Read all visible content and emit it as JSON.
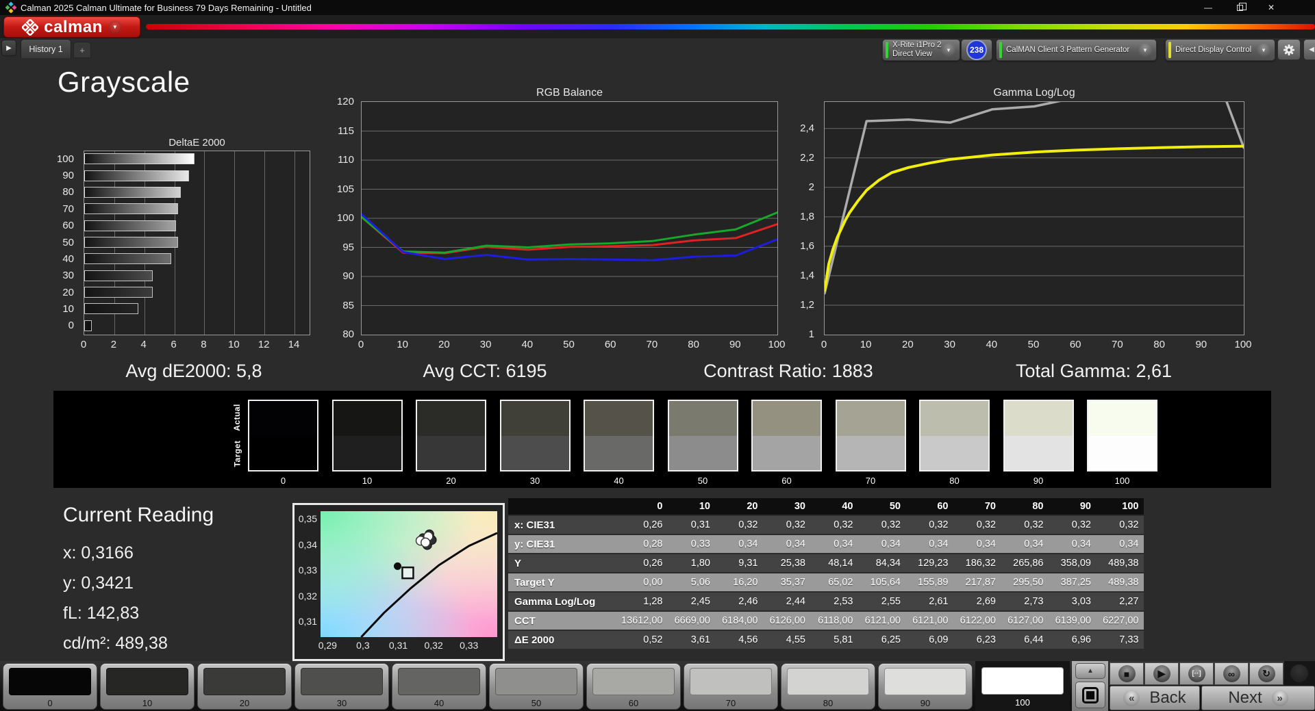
{
  "window": {
    "title": "Calman 2025 Calman Ultimate for Business 79 Days Remaining  - Untitled"
  },
  "brand": {
    "logo_text": "calman"
  },
  "tabs": {
    "history": "History 1",
    "add": "+"
  },
  "toolbar": {
    "meter": {
      "line1": "X-Rite i1Pro 2",
      "line2": "Direct View",
      "badge": "238",
      "accent": "#35d435"
    },
    "pattern_generator": {
      "label": "CalMAN Client 3 Pattern Generator",
      "accent": "#35d435"
    },
    "display_control": {
      "label": "Direct Display Control",
      "accent": "#e3df2e"
    }
  },
  "page": {
    "title": "Grayscale"
  },
  "stats": [
    "Avg dE2000: 5,8",
    "Avg CCT: 6195",
    "Contrast Ratio: 1883",
    "Total Gamma: 2,61"
  ],
  "chart_data": [
    {
      "type": "bar",
      "title": "DeltaE 2000",
      "orientation": "horizontal",
      "categories": [
        "100",
        "90",
        "80",
        "70",
        "60",
        "50",
        "40",
        "30",
        "20",
        "10",
        "0"
      ],
      "values": [
        7.33,
        6.96,
        6.44,
        6.23,
        6.09,
        6.25,
        5.81,
        4.55,
        4.56,
        3.61,
        0.52
      ],
      "xlim": [
        0,
        15
      ],
      "xticks": [
        0,
        2,
        4,
        6,
        8,
        10,
        12,
        14
      ],
      "bar_colors": [
        "#ffffff",
        "#e9e9e9",
        "#d2d2d2",
        "#bcbcbc",
        "#a5a5a5",
        "#8f8f8f",
        "#6f6f6f",
        "#4c4c4c",
        "#3b3b3b",
        "#242424",
        "#0d0d0d"
      ]
    },
    {
      "type": "line",
      "title": "RGB Balance",
      "x": [
        0,
        10,
        20,
        30,
        40,
        50,
        60,
        70,
        80,
        90,
        100
      ],
      "xlim": [
        0,
        100
      ],
      "ylim": [
        80,
        120
      ],
      "yticks": [
        {
          "v": 120,
          "label": "120"
        },
        {
          "v": 115,
          "label": "115"
        },
        {
          "v": 110,
          "label": "110"
        },
        {
          "v": 105,
          "label": "105"
        },
        {
          "v": 100,
          "label": "100"
        },
        {
          "v": 95,
          "label": "95"
        },
        {
          "v": 90,
          "label": "90"
        },
        {
          "v": 85,
          "label": "85"
        },
        {
          "v": 80,
          "label": "80"
        }
      ],
      "xticks": [
        0,
        10,
        20,
        30,
        40,
        50,
        60,
        70,
        80,
        90,
        100
      ],
      "series": [
        {
          "name": "Red",
          "color": "#de2323",
          "values": [
            100.2,
            94.1,
            94.0,
            95.1,
            94.6,
            95.1,
            95.2,
            95.4,
            96.2,
            96.6,
            99.0
          ]
        },
        {
          "name": "Green",
          "color": "#17a82b",
          "values": [
            100.2,
            94.3,
            94.1,
            95.3,
            95.0,
            95.5,
            95.7,
            96.1,
            97.2,
            98.1,
            101.0
          ]
        },
        {
          "name": "Blue",
          "color": "#1d1de0",
          "values": [
            100.7,
            94.2,
            93.0,
            93.7,
            92.9,
            93.0,
            92.9,
            92.8,
            93.4,
            93.6,
            96.4
          ]
        }
      ]
    },
    {
      "type": "line",
      "title": "Gamma Log/Log",
      "xlim": [
        0,
        100
      ],
      "ylim": [
        1,
        2.58
      ],
      "yticks": [
        {
          "v": 2.4,
          "label": "2,4"
        },
        {
          "v": 2.2,
          "label": "2,2"
        },
        {
          "v": 2.0,
          "label": "2"
        },
        {
          "v": 1.8,
          "label": "1,8"
        },
        {
          "v": 1.6,
          "label": "1,6"
        },
        {
          "v": 1.4,
          "label": "1,4"
        },
        {
          "v": 1.2,
          "label": "1,2"
        },
        {
          "v": 1.0,
          "label": "1"
        }
      ],
      "xticks": [
        0,
        10,
        20,
        30,
        40,
        50,
        60,
        70,
        80,
        90,
        100
      ],
      "series": [
        {
          "name": "Measured Gamma",
          "color": "#ababab",
          "width": 3.5,
          "x": [
            0,
            10,
            20,
            30,
            40,
            50,
            60,
            70,
            80,
            90,
            100
          ],
          "values": [
            1.28,
            2.45,
            2.46,
            2.44,
            2.53,
            2.55,
            2.61,
            2.69,
            2.73,
            3.03,
            2.27
          ]
        },
        {
          "name": "Target Gamma",
          "color": "#f2ee12",
          "width": 4,
          "x": [
            0,
            1,
            2,
            3,
            4,
            5,
            6,
            8,
            10,
            13,
            16,
            20,
            25,
            30,
            35,
            40,
            50,
            60,
            70,
            80,
            90,
            100
          ],
          "values": [
            1.3,
            1.48,
            1.58,
            1.66,
            1.72,
            1.78,
            1.83,
            1.91,
            1.98,
            2.05,
            2.1,
            2.135,
            2.165,
            2.19,
            2.205,
            2.22,
            2.24,
            2.253,
            2.262,
            2.27,
            2.276,
            2.28
          ]
        }
      ]
    },
    {
      "type": "scatter",
      "title": "CIE xy chromaticity detail",
      "xlim": [
        0.288,
        0.338
      ],
      "ylim": [
        0.304,
        0.353
      ],
      "xticks": [
        {
          "v": 0.29,
          "label": "0,29"
        },
        {
          "v": 0.3,
          "label": "0,3"
        },
        {
          "v": 0.31,
          "label": "0,31"
        },
        {
          "v": 0.32,
          "label": "0,32"
        },
        {
          "v": 0.33,
          "label": "0,33"
        }
      ],
      "yticks": [
        {
          "v": 0.35,
          "label": "0,35"
        },
        {
          "v": 0.34,
          "label": "0,34"
        },
        {
          "v": 0.33,
          "label": "0,33"
        },
        {
          "v": 0.32,
          "label": "0,32"
        },
        {
          "v": 0.31,
          "label": "0,31"
        }
      ],
      "locus": [
        [
          0.2995,
          0.304
        ],
        [
          0.306,
          0.3135
        ],
        [
          0.3135,
          0.323
        ],
        [
          0.3215,
          0.332
        ],
        [
          0.33,
          0.3395
        ],
        [
          0.338,
          0.3445
        ]
      ],
      "measured_points": [
        [
          0.3163,
          0.3415
        ],
        [
          0.3185,
          0.3432
        ],
        [
          0.3177,
          0.3408
        ]
      ],
      "dark_points": [
        [
          0.3182,
          0.3398
        ],
        [
          0.3195,
          0.3418
        ],
        [
          0.317,
          0.3425
        ],
        [
          0.3188,
          0.344
        ]
      ],
      "reading_point": [
        0.3098,
        0.3316
      ],
      "target_point": [
        0.3127,
        0.329
      ]
    }
  ],
  "swatch_strip": {
    "row_labels": [
      "Actual",
      "Target"
    ],
    "levels": [
      "0",
      "10",
      "20",
      "30",
      "40",
      "50",
      "60",
      "70",
      "80",
      "90",
      "100"
    ],
    "actual_colors": [
      "#020204",
      "#161614",
      "#2b2b27",
      "#403f38",
      "#555349",
      "#7b7a6f",
      "#949180",
      "#a5a494",
      "#bdbdad",
      "#dcdcca",
      "#f7fcef"
    ],
    "target_colors": [
      "#000000",
      "#1f1f1f",
      "#373737",
      "#4d4d4d",
      "#696968",
      "#8c8c8c",
      "#a4a4a4",
      "#b5b5b5",
      "#c9c9c9",
      "#e3e3e3",
      "#fdfdfd"
    ]
  },
  "current_reading": {
    "title": "Current Reading",
    "lines": [
      "x: 0,3166",
      "y: 0,3421",
      "fL: 142,83",
      "cd/m²: 489,38"
    ]
  },
  "table": {
    "col_headers": [
      "",
      "0",
      "10",
      "20",
      "30",
      "40",
      "50",
      "60",
      "70",
      "80",
      "90",
      "100"
    ],
    "rows": [
      {
        "label": "x: CIE31",
        "tone": "dark",
        "values": [
          "0,26",
          "0,31",
          "0,32",
          "0,32",
          "0,32",
          "0,32",
          "0,32",
          "0,32",
          "0,32",
          "0,32",
          "0,32"
        ]
      },
      {
        "label": "y: CIE31",
        "tone": "light",
        "values": [
          "0,28",
          "0,33",
          "0,34",
          "0,34",
          "0,34",
          "0,34",
          "0,34",
          "0,34",
          "0,34",
          "0,34",
          "0,34"
        ]
      },
      {
        "label": "Y",
        "tone": "dark",
        "values": [
          "0,26",
          "1,80",
          "9,31",
          "25,38",
          "48,14",
          "84,34",
          "129,23",
          "186,32",
          "265,86",
          "358,09",
          "489,38"
        ]
      },
      {
        "label": "Target Y",
        "tone": "light",
        "values": [
          "0,00",
          "5,06",
          "16,20",
          "35,37",
          "65,02",
          "105,64",
          "155,89",
          "217,87",
          "295,50",
          "387,25",
          "489,38"
        ]
      },
      {
        "label": "Gamma Log/Log",
        "tone": "dark",
        "values": [
          "1,28",
          "2,45",
          "2,46",
          "2,44",
          "2,53",
          "2,55",
          "2,61",
          "2,69",
          "2,73",
          "3,03",
          "2,27"
        ]
      },
      {
        "label": "CCT",
        "tone": "light",
        "values": [
          "13612,00",
          "6669,00",
          "6184,00",
          "6126,00",
          "6118,00",
          "6121,00",
          "6121,00",
          "6122,00",
          "6127,00",
          "6139,00",
          "6227,00"
        ]
      },
      {
        "label": "ΔE 2000",
        "tone": "dark",
        "values": [
          "0,52",
          "3,61",
          "4,56",
          "4,55",
          "5,81",
          "6,25",
          "6,09",
          "6,23",
          "6,44",
          "6,96",
          "7,33"
        ]
      }
    ]
  },
  "bottom_bar": {
    "patterns": [
      {
        "level": "0",
        "color": "#060606"
      },
      {
        "level": "10",
        "color": "#262624"
      },
      {
        "level": "20",
        "color": "#3a3a38"
      },
      {
        "level": "30",
        "color": "#4f4f4d"
      },
      {
        "level": "40",
        "color": "#646462"
      },
      {
        "level": "50",
        "color": "#8f8f8d"
      },
      {
        "level": "60",
        "color": "#a8a8a5"
      },
      {
        "level": "70",
        "color": "#c0c0bf"
      },
      {
        "level": "80",
        "color": "#d3d3d1"
      },
      {
        "level": "90",
        "color": "#dededd"
      },
      {
        "level": "100",
        "color": "#ffffff"
      }
    ],
    "selected_level": "100",
    "transport": [
      {
        "name": "stop",
        "glyph": "■",
        "fg": "#101010"
      },
      {
        "name": "play",
        "glyph": "▶",
        "fg": "#101010"
      },
      {
        "name": "step",
        "glyph": "[··]",
        "fg": "#e6e6e6"
      },
      {
        "name": "continuous",
        "glyph": "∞",
        "fg": "#101010"
      },
      {
        "name": "refresh",
        "glyph": "↻",
        "fg": "#101010"
      }
    ],
    "nav": {
      "back_label": "Back",
      "next_label": "Next"
    }
  },
  "icons": {
    "dropdown": "▼",
    "up_arrow": "▲",
    "nav_forward": "▶",
    "collapse_left": "◀",
    "back_chevrons": "«",
    "next_chevrons": "»",
    "minimize": "—",
    "close": "✕",
    "plus": "+"
  }
}
